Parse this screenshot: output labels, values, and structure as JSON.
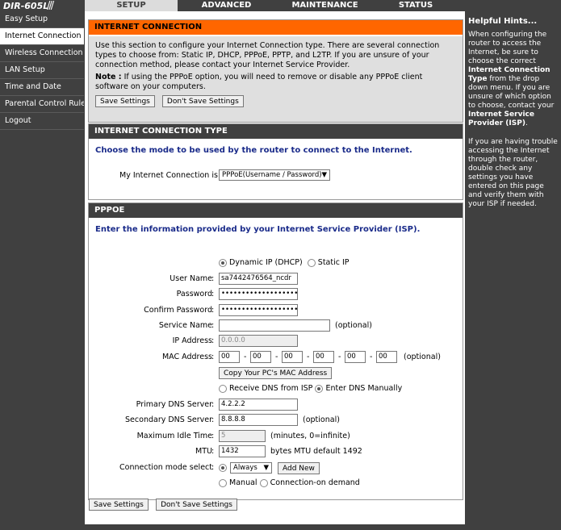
{
  "brand": "DIR-605L",
  "tabs": [
    "SETUP",
    "ADVANCED",
    "MAINTENANCE",
    "STATUS"
  ],
  "sidebar": [
    "Easy Setup",
    "Internet Connection",
    "Wireless Connection",
    "LAN Setup",
    "Time and Date",
    "Parental Control Rules",
    "Logout"
  ],
  "intro": {
    "title": "INTERNET CONNECTION",
    "text": "Use this section to configure your Internet Connection type. There are several connection types to choose from: Static IP, DHCP, PPPoE, PPTP, and L2TP. If you are unsure of your connection method, please contact your Internet Service Provider.",
    "note_label": "Note :",
    "note_text": " If using the PPPoE option, you will need to remove or disable any PPPoE client software on your computers.",
    "save": "Save Settings",
    "dont_save": "Don't Save Settings"
  },
  "type_panel": {
    "title": "INTERNET CONNECTION TYPE",
    "heading": "Choose the mode to be used by the router to connect to the Internet.",
    "label": "My Internet Connection is :",
    "selected": "PPPoE(Username / Password)"
  },
  "pppoe": {
    "title": "PPPOE",
    "heading": "Enter the information provided by your Internet Service Provider (ISP).",
    "dynamic_label": "Dynamic IP (DHCP)",
    "static_label": "Static IP",
    "username_label": "User Name",
    "username": "sa7442476564_ncdr",
    "password_label": "Password",
    "password": "••••••••••••••••••••••••",
    "confirm_label": "Confirm Password",
    "confirm": "••••••••••••••••••••••••",
    "service_label": "Service Name",
    "service": "",
    "optional": "(optional)",
    "ip_label": "IP Address",
    "ip": "0.0.0.0",
    "mac_label": "MAC Address",
    "mac": [
      "00",
      "00",
      "00",
      "00",
      "00",
      "00"
    ],
    "mac_sep": "-",
    "copy_mac": "Copy Your PC's MAC Address",
    "receive_dns": "Receive DNS from ISP",
    "manual_dns": "Enter DNS Manually",
    "dns1_label": "Primary DNS Server",
    "dns1": "4.2.2.2",
    "dns2_label": "Secondary DNS Server",
    "dns2": "8.8.8.8",
    "idle_label": "Maximum Idle Time",
    "idle": "5",
    "idle_unit": "(minutes, 0=infinite)",
    "mtu_label": "MTU",
    "mtu": "1432",
    "mtu_unit": "bytes MTU default 1492",
    "conn_label": "Connection mode select",
    "conn_value": "Always",
    "add_new": "Add New",
    "manual": "Manual",
    "on_demand": "Connection-on demand",
    "colon": ":"
  },
  "help": {
    "title": "Helpful Hints...",
    "p1a": "When configuring the router to access the Internet, be sure to choose the correct ",
    "p1b": "Internet Connection Type",
    "p1c": " from the drop down menu. If you are unsure of which option to choose, contact your ",
    "p1d": "Internet Service Provider (ISP)",
    "p1e": ".",
    "p2": "If you are having trouble accessing the Internet through the router, double check any settings you have entered on this page and verify them with your ISP if needed."
  }
}
